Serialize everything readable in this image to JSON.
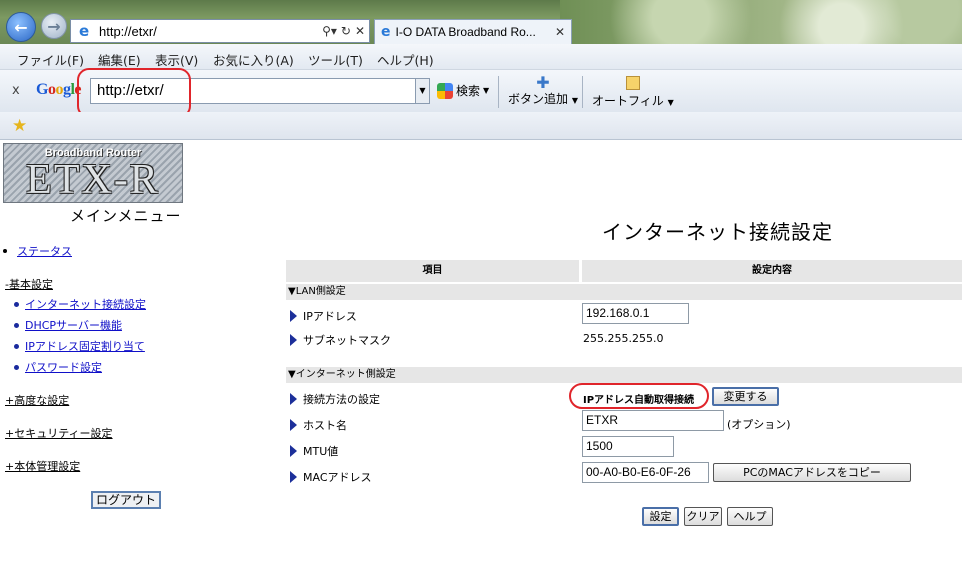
{
  "browser": {
    "address_url": "http://etxr/",
    "tab_title": "I-O DATA Broadband Ro...",
    "menu": [
      "ファイル(F)",
      "編集(E)",
      "表示(V)",
      "お気に入り(A)",
      "ツール(T)",
      "ヘルプ(H)"
    ],
    "google": {
      "close": "x",
      "logo": "Google",
      "search_value": "http://etxr/",
      "search_label": "検索",
      "add_button_label": "ボタン追加",
      "autofill_label": "オートフィル"
    }
  },
  "logo": {
    "top_text": "Broadband Router",
    "main_text": "ETX-R"
  },
  "sidebar": {
    "title": "メインメニュー",
    "status": "ステータス",
    "basic_section": "-基本設定",
    "basic_items": [
      "インターネット接続設定",
      "DHCPサーバー機能",
      "IPアドレス固定割り当て",
      "パスワード設定"
    ],
    "advanced_section": "+高度な設定",
    "security_section": "+セキュリティー設定",
    "device_section": "+本体管理設定",
    "logout_label": "ログアウト"
  },
  "main": {
    "title": "インターネット接続設定",
    "col_item": "項目",
    "col_setting": "設定内容",
    "lan_section": "▼LAN側設定",
    "ip_label": "IPアドレス",
    "ip_value": "192.168.0.1",
    "subnet_label": "サブネットマスク",
    "subnet_value": "255.255.255.0",
    "wan_section": "▼インターネット側設定",
    "conn_label": "接続方法の設定",
    "conn_value": "IPアドレス自動取得接続",
    "change_button": "変更する",
    "host_label": "ホスト名",
    "host_value": "ETXR",
    "host_option": "(オプション)",
    "mtu_label": "MTU値",
    "mtu_value": "1500",
    "mac_label": "MACアドレス",
    "mac_value": "00-A0-B0-E6-0F-26",
    "copy_mac_button": "PCのMACアドレスをコピー",
    "save_button": "設定",
    "clear_button": "クリア",
    "help_button": "ヘルプ"
  }
}
